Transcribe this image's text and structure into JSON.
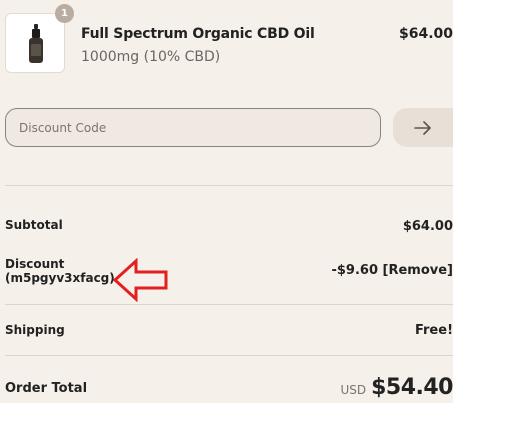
{
  "product": {
    "quantity": "1",
    "name": "Full Spectrum Organic CBD Oil",
    "variant": "1000mg (10% CBD)",
    "price": "$64.00"
  },
  "discount_form": {
    "placeholder": "Discount Code",
    "apply_icon": "arrow-right-icon"
  },
  "summary": {
    "subtotal_label": "Subtotal",
    "subtotal_value": "$64.00",
    "discount_label": "Discount",
    "discount_code": "(m5pgyv3xfacg)",
    "discount_value": "-$9.60",
    "remove_label": "[Remove]",
    "shipping_label": "Shipping",
    "shipping_value": "Free!",
    "total_label": "Order Total",
    "currency": "USD",
    "total_value": "$54.40"
  },
  "annotation": {
    "icon": "red-arrow-left-icon",
    "color": "#e0201f"
  },
  "colors": {
    "panel_background": "#f6f0ea",
    "text": "#222222",
    "muted_text": "#6b6661",
    "divider": "#ddd4ca"
  }
}
